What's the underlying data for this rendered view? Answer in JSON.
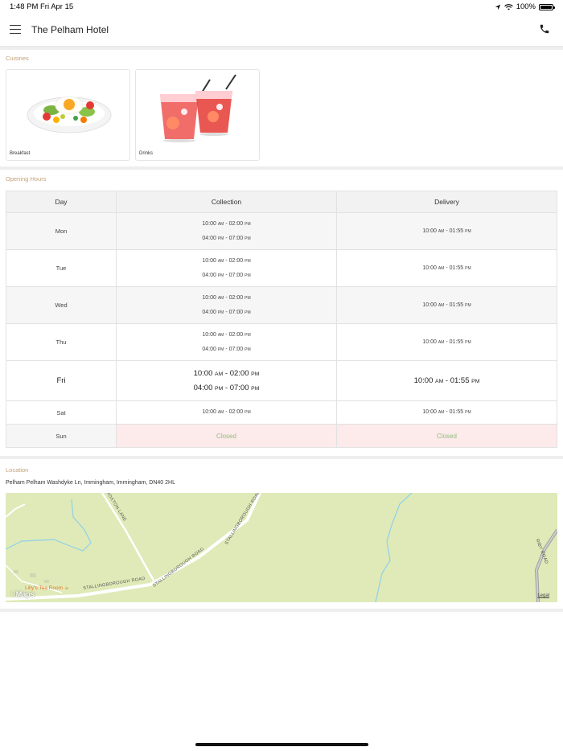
{
  "status_bar": {
    "time": "1:48 PM",
    "date": "Fri Apr 15",
    "battery": "100%"
  },
  "header": {
    "title": "The Pelham Hotel",
    "menu_icon": "hamburger-menu-icon",
    "call_icon": "phone-icon"
  },
  "cuisines": {
    "label": "Cuisines",
    "items": [
      {
        "name": "Breakfast",
        "image": "breakfast-plate-image"
      },
      {
        "name": "Drinks",
        "image": "drinks-glasses-image"
      }
    ]
  },
  "opening_hours": {
    "label": "Opening Hours",
    "columns": [
      "Day",
      "Collection",
      "Delivery"
    ],
    "rows": [
      {
        "day": "Mon",
        "collection": [
          [
            "10:00",
            "AM",
            "02:00",
            "PM"
          ],
          [
            "04:00",
            "PM",
            "07:00",
            "PM"
          ]
        ],
        "delivery": [
          [
            "10:00",
            "AM",
            "01:55",
            "PM"
          ]
        ]
      },
      {
        "day": "Tue",
        "collection": [
          [
            "10:00",
            "AM",
            "02:00",
            "PM"
          ],
          [
            "04:00",
            "PM",
            "07:00",
            "PM"
          ]
        ],
        "delivery": [
          [
            "10:00",
            "AM",
            "01:55",
            "PM"
          ]
        ]
      },
      {
        "day": "Wed",
        "collection": [
          [
            "10:00",
            "AM",
            "02:00",
            "PM"
          ],
          [
            "04:00",
            "PM",
            "07:00",
            "PM"
          ]
        ],
        "delivery": [
          [
            "10:00",
            "AM",
            "01:55",
            "PM"
          ]
        ]
      },
      {
        "day": "Thu",
        "collection": [
          [
            "10:00",
            "AM",
            "02:00",
            "PM"
          ],
          [
            "04:00",
            "PM",
            "07:00",
            "PM"
          ]
        ],
        "delivery": [
          [
            "10:00",
            "AM",
            "01:55",
            "PM"
          ]
        ]
      },
      {
        "day": "Fri",
        "today": true,
        "collection": [
          [
            "10:00",
            "AM",
            "02:00",
            "PM"
          ],
          [
            "04:00",
            "PM",
            "07:00",
            "PM"
          ]
        ],
        "delivery": [
          [
            "10:00",
            "AM",
            "01:55",
            "PM"
          ]
        ]
      },
      {
        "day": "Sat",
        "collection": [
          [
            "10:00",
            "AM",
            "02:00",
            "PM"
          ]
        ],
        "delivery": [
          [
            "10:00",
            "AM",
            "01:55",
            "PM"
          ]
        ]
      },
      {
        "day": "Sun",
        "closed": true,
        "collection_text": "Closed",
        "delivery_text": "Closed"
      }
    ]
  },
  "location": {
    "label": "Location",
    "address": "Pelham Pelham Washdyke Ln, Immingham, Immingham, DN40 2HL",
    "map": {
      "brand": "Maps",
      "legal": "Legal",
      "poi": "Lilly's Tea Room",
      "roads": [
        "STALLINGBOROUGH ROAD",
        "STALLINGBOROUGH ROAD",
        "STALLINGBOROUGH ROAD",
        "ROXTON LANE",
        "RIBY ROAD"
      ]
    }
  },
  "colors": {
    "section_label": "#c2a178",
    "closed_bg": "#fdeaea",
    "closed_text": "#8fbf7b",
    "map_land": "#dfeab8"
  }
}
